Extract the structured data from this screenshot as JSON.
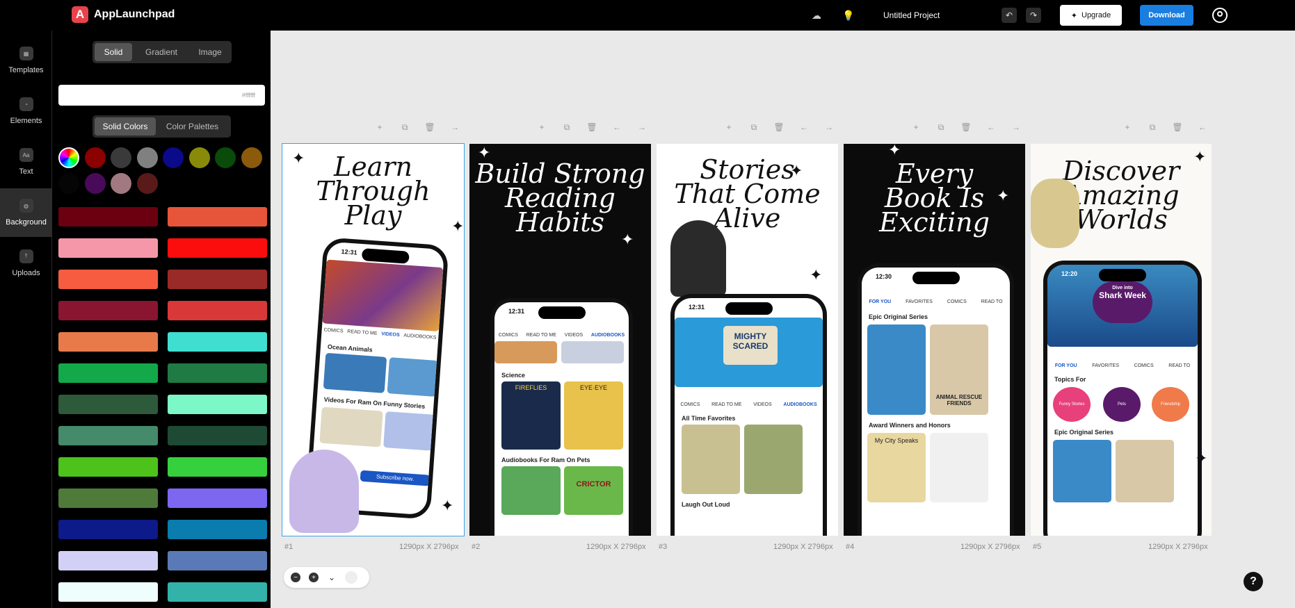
{
  "app": {
    "name": "AppLaunchpad",
    "logo_letter": "A"
  },
  "header": {
    "project_name": "Untitled Project",
    "upgrade_label": "Upgrade",
    "download_label": "Download"
  },
  "leftnav": [
    {
      "label": "Templates",
      "icon": "templates-icon"
    },
    {
      "label": "Elements",
      "icon": "elements-icon"
    },
    {
      "label": "Text",
      "icon": "text-icon",
      "glyph": "Aa"
    },
    {
      "label": "Background",
      "icon": "background-icon",
      "active": true
    },
    {
      "label": "Uploads",
      "icon": "uploads-icon"
    }
  ],
  "panel": {
    "fill_tabs": [
      "Solid",
      "Gradient",
      "Image"
    ],
    "hex_value": "#ffffff",
    "color_tabs": [
      "Solid Colors",
      "Color Palettes"
    ],
    "swatches": [
      "#8b0000",
      "#3a3a3a",
      "#808080",
      "#0a0a8a",
      "#8a8a0a",
      "#0a4a0a",
      "#8b5a0a",
      "#050505",
      "#4a0a5a",
      "#a07a80",
      "#5a1a1a"
    ],
    "bars_left": [
      "#6b0010",
      "#f597a8",
      "#f75c40",
      "#8a1530",
      "#e87a4a",
      "#13a84a",
      "#2c5a3a",
      "#458a6a",
      "#4cc21a",
      "#4e7a3a",
      "#0d1a8a",
      "#d3d0f7",
      "#eefefd"
    ],
    "bars_right": [
      "#e6553a",
      "#fc0d0d",
      "#9a2a28",
      "#d83838",
      "#40ded0",
      "#1f7a44",
      "#7cf7c8",
      "#1e4a35",
      "#35d03d",
      "#7d66f0",
      "#0a7cae",
      "#5a7ab7",
      "#33b2aa"
    ]
  },
  "frames": [
    {
      "num": "#1",
      "size": "1290px X 2796px",
      "headline": [
        "Learn",
        "Through",
        "Play"
      ],
      "bg": "#ffffff",
      "fg": "#111111"
    },
    {
      "num": "#2",
      "size": "1290px X 2796px",
      "headline": [
        "Build Strong",
        "Reading",
        "Habits"
      ],
      "bg": "#0b0b0b",
      "fg": "#ffffff"
    },
    {
      "num": "#3",
      "size": "1290px X 2796px",
      "headline": [
        "Stories",
        "That Come",
        "Alive"
      ],
      "bg": "#ffffff",
      "fg": "#111111"
    },
    {
      "num": "#4",
      "size": "1290px X 2796px",
      "headline": [
        "Every",
        "Book Is",
        "Exciting"
      ],
      "bg": "#0b0b0b",
      "fg": "#ffffff"
    },
    {
      "num": "#5",
      "size": "1290px X 2796px",
      "headline": [
        "Discover",
        "Amazing",
        "Worlds"
      ],
      "bg": "#faf9f6",
      "fg": "#111111"
    }
  ],
  "phone_text": {
    "time": "12:31",
    "time4": "12:30",
    "time5": "12:20",
    "tabs_a": [
      "COMICS",
      "READ TO ME",
      "VIDEOS",
      "AUDIOBOOKS"
    ],
    "tabs_b": [
      "FOR YOU",
      "FAVORITES",
      "COMICS",
      "READ TO"
    ],
    "f1_sections": [
      "Ocean Animals",
      "Videos For Ram On Funny Stories"
    ],
    "f1_banner": "Subscribe now.",
    "f2_sections": [
      "Science",
      "Audiobooks For Ram On Pets"
    ],
    "f2_tiles": [
      "FIREFLIES",
      "EYE·EYE",
      "CRICTOR"
    ],
    "f3_hero": "MIGHTY SCARED",
    "f3_sections": [
      "All Time Favorites",
      "Laugh Out Loud"
    ],
    "f4_sections": [
      "Epic Original Series",
      "Award Winners and Honors"
    ],
    "f4_tiles": [
      "ANIMAL RESCUE FRIENDS",
      "My City Speaks"
    ],
    "f5_hero": [
      "Dive into",
      "Shark Week"
    ],
    "f5_sections": [
      "Topics For",
      "Epic Original Series"
    ],
    "f5_topics": [
      "Funny Stories",
      "Pets",
      "Friendship"
    ]
  }
}
